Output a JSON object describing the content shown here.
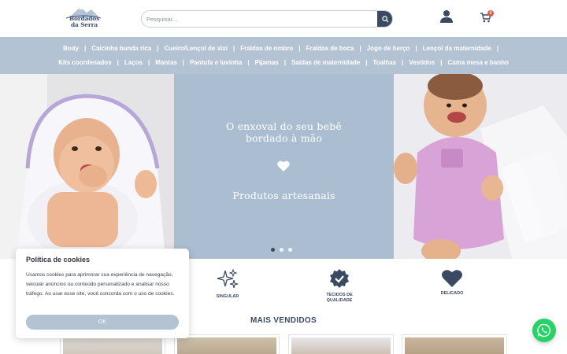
{
  "header": {
    "logo_text_line1": "Bordados",
    "logo_text_line2": "da Serra",
    "search_placeholder": "Pesquisar...",
    "cart_count": "0"
  },
  "nav": {
    "row1": [
      "Body",
      "Calcinha bunda rica",
      "Cueiro/Lençol de xixi",
      "Fraldas de ombro",
      "Fraldas de boca",
      "Jogo de berço",
      "Lençol da maternidade"
    ],
    "row2": [
      "Kits coordenados",
      "Laços",
      "Mantas",
      "Pantufa e luvinha",
      "Pijamas",
      "Saídas de maternidade",
      "Toalhas",
      "Vestidos",
      "Cama mesa e banho"
    ]
  },
  "hero": {
    "title_line1": "O enxoval do seu bebê",
    "title_line2": "bordado à mão",
    "subtitle": "Produtos artesanais",
    "active_slide": 1,
    "slide_count": 3
  },
  "features": [
    {
      "label": "SINGULAR",
      "icon": "sparkles-icon"
    },
    {
      "label_line1": "TECIDOS DE",
      "label_line2": "QUALIDADE",
      "icon": "badge-check-icon"
    },
    {
      "label": "DELICADO",
      "icon": "heart-icon"
    }
  ],
  "best_sellers": {
    "title": "MAIS VENDIDOS"
  },
  "cookie": {
    "title": "Política de cookies",
    "text": "Usamos cookies para aprimorar sua experiência de navegação, veicular anúncios ou conteúdo personalizado e analisar nosso tráfego. Ao usar esse site, você concorda com o uso de cookies.",
    "button": "OK"
  },
  "colors": {
    "nav_bg": "#b3c3d3",
    "hero_bg": "#abbed1",
    "brand_dark": "#3b4a63",
    "whatsapp": "#25d366"
  }
}
